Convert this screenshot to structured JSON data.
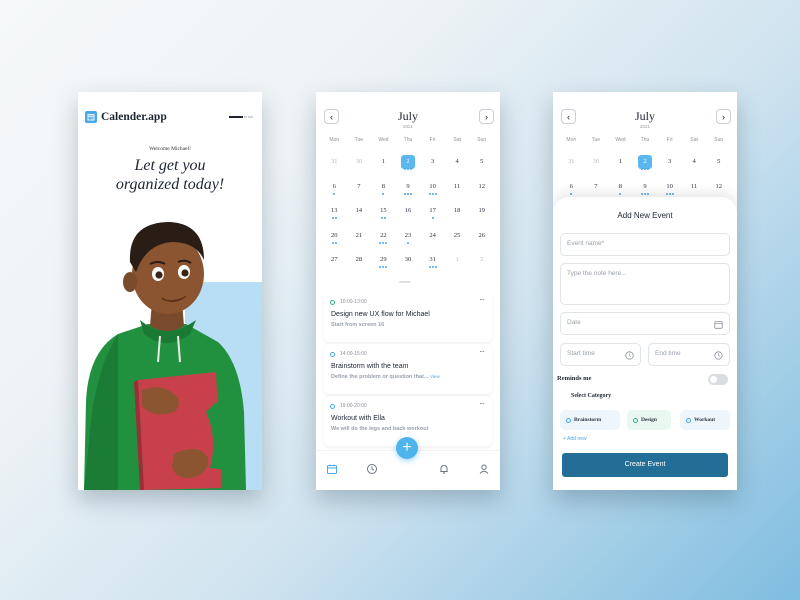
{
  "brand": {
    "app_name": "Calender.app",
    "accent": "#4aa8e8",
    "button_color": "#226e97"
  },
  "onboarding": {
    "welcome": "Welcome Michael!",
    "headline_line1": "Let get you",
    "headline_line2": "organized today!"
  },
  "calendar": {
    "month": "July",
    "year": "2021",
    "weekdays": [
      "Mon",
      "Tue",
      "Wed",
      "Thu",
      "Fri",
      "Sat",
      "Sun"
    ],
    "weeks": [
      [
        "31",
        "30",
        "1",
        "2",
        "3",
        "4",
        "5"
      ],
      [
        "6",
        "7",
        "8",
        "9",
        "10",
        "11",
        "12"
      ],
      [
        "13",
        "14",
        "15",
        "16",
        "17",
        "18",
        "19"
      ],
      [
        "20",
        "21",
        "22",
        "23",
        "24",
        "25",
        "26"
      ],
      [
        "27",
        "28",
        "29",
        "30",
        "31",
        "1",
        "2"
      ]
    ],
    "selected_day": "2"
  },
  "events": [
    {
      "time": "10:00-13:00",
      "title": "Design new UX flow for Michael",
      "subtitle": "Start from screen 16",
      "link": ""
    },
    {
      "time": "14:00-15:00",
      "title": "Brainstorm with the team",
      "subtitle": "Define the problem or question that...",
      "link": "View"
    },
    {
      "time": "19:00-20:00",
      "title": "Workout with Ella",
      "subtitle": "We will do the legs and back workout",
      "link": ""
    }
  ],
  "bottom_nav": {
    "fab_label": "+",
    "items": [
      "calendar-icon",
      "clock-icon",
      "bell-icon",
      "profile-icon"
    ]
  },
  "new_event": {
    "title": "Add New Event",
    "event_name_placeholder": "Event name*",
    "note_placeholder": "Type the note here...",
    "date_placeholder": "Date",
    "start_placeholder": "Start time",
    "end_placeholder": "End time",
    "remind_label": "Reminds me",
    "remind_on": false,
    "category_label": "Select Category",
    "categories": [
      "Brainstorm",
      "Design",
      "Workout"
    ],
    "add_new": "+ Add new",
    "create_label": "Create Event"
  }
}
